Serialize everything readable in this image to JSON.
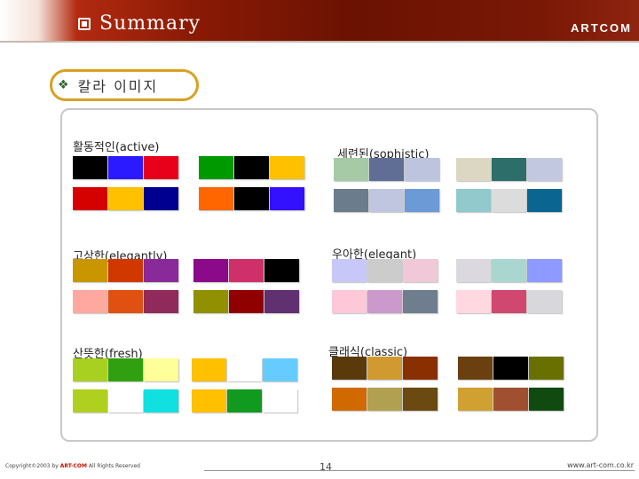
{
  "header": {
    "title": "Summary",
    "brand": "ARTCOM"
  },
  "section": {
    "label": "칼라 이미지"
  },
  "categories": [
    {
      "id": "active",
      "label": "활동적인(active)",
      "groups": [
        {
          "rows": [
            [
              "#000000",
              "#2b1aff",
              "#e8001a"
            ],
            [
              "#d50000",
              "#ffc000",
              "#000090"
            ]
          ]
        },
        {
          "rows": [
            [
              "#009900",
              "#000000",
              "#ffc000"
            ],
            [
              "#ff6600",
              "#000000",
              "#3311ff"
            ]
          ]
        }
      ]
    },
    {
      "id": "sophistic",
      "label": "세련된(sophistic)",
      "groups": [
        {
          "rows": [
            [
              "#a6c9a6",
              "#606e96",
              "#bcc4de"
            ],
            [
              "#6b7c8c",
              "#c0c6e0",
              "#6b9ad6"
            ]
          ]
        },
        {
          "rows": [
            [
              "#dcd7c2",
              "#2d6e6a",
              "#c2c8e0"
            ],
            [
              "#92c9cc",
              "#dcdcdc",
              "#0a6690"
            ]
          ]
        }
      ]
    },
    {
      "id": "elegantly",
      "label": "고상한(elegantly)",
      "groups": [
        {
          "rows": [
            [
              "#c99600",
              "#d03800",
              "#8a2a9a"
            ],
            [
              "#ffa8a0",
              "#e05010",
              "#902a5a"
            ]
          ]
        },
        {
          "rows": [
            [
              "#8a0a8a",
              "#d0306a",
              "#000000"
            ],
            [
              "#909000",
              "#900000",
              "#603070"
            ]
          ]
        }
      ]
    },
    {
      "id": "elegant",
      "label": "우아한(elegant)",
      "groups": [
        {
          "rows": [
            [
              "#c8c8f8",
              "#cccccc",
              "#f0c8d8"
            ],
            [
              "#ffc8d8",
              "#cc99cc",
              "#6e7e8e"
            ]
          ]
        },
        {
          "rows": [
            [
              "#dcd8e0",
              "#aad6d0",
              "#8e9aff"
            ],
            [
              "#ffd8e0",
              "#d04870",
              "#d8d8dc"
            ]
          ]
        }
      ]
    },
    {
      "id": "fresh",
      "label": "산뜻한(fresh)",
      "groups": [
        {
          "rows": [
            [
              "#a8d020",
              "#30a010",
              "#ffff99"
            ],
            [
              "#b0d020",
              "#ffffff",
              "#10e0e0"
            ]
          ]
        },
        {
          "rows": [
            [
              "#ffc000",
              "#ffffff",
              "#66ccff"
            ],
            [
              "#ffc000",
              "#109a20",
              "#ffffff"
            ]
          ]
        }
      ]
    },
    {
      "id": "classic",
      "label": "클래식(classic)",
      "groups": [
        {
          "rows": [
            [
              "#5a3a0a",
              "#d09a30",
              "#8a3000"
            ],
            [
              "#d06a00",
              "#b0a050",
              "#6a4a10"
            ]
          ]
        },
        {
          "rows": [
            [
              "#6a4010",
              "#000000",
              "#6a7000"
            ],
            [
              "#d0a030",
              "#a05030",
              "#104a10"
            ]
          ]
        }
      ]
    }
  ],
  "footer": {
    "copyright_prefix": "Copyright©2003 by ",
    "copyright_brand": "ART-COM",
    "copyright_suffix": " All Rights Reserved",
    "page": "14",
    "site": "www.art-com.co.kr"
  }
}
